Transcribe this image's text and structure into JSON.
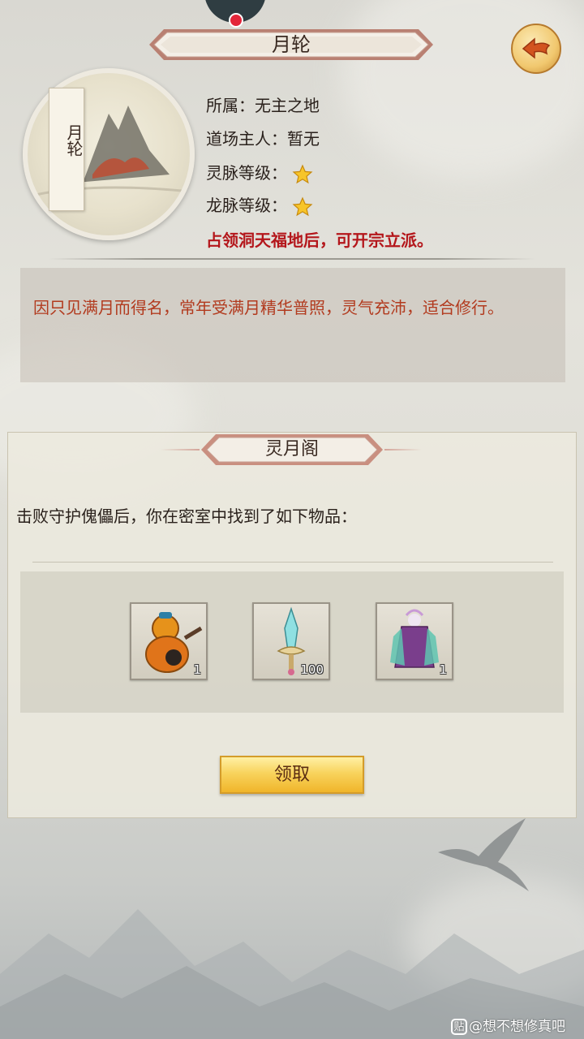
{
  "header": {
    "title": "月轮",
    "back_icon": "back-arrow-icon"
  },
  "location": {
    "emblem_label": "月轮",
    "belongs_to": "所属：无主之地",
    "owner": "道场主人：暂无",
    "spirit_vein_label": "灵脉等级：",
    "spirit_vein_stars": 1,
    "dragon_vein_label": "龙脉等级：",
    "dragon_vein_stars": 1,
    "hint": "占领洞天福地后，可开宗立派。",
    "description": "因只见满月而得名，常年受满月精华普照，灵气充沛，适合修行。"
  },
  "reward_panel": {
    "title": "灵月阁",
    "prompt": "击败守护傀儡后，你在密室中找到了如下物品：",
    "items": [
      {
        "icon": "gourd-icon",
        "count": "1"
      },
      {
        "icon": "sword-icon",
        "count": "100"
      },
      {
        "icon": "robe-icon",
        "count": "1"
      }
    ],
    "claim_label": "领取"
  },
  "watermark": {
    "logo": "贴",
    "text": "@想不想修真吧"
  },
  "colors": {
    "hint_red": "#b4161b",
    "description_text": "#b23a1e",
    "button_gold": "#f8d35d"
  }
}
